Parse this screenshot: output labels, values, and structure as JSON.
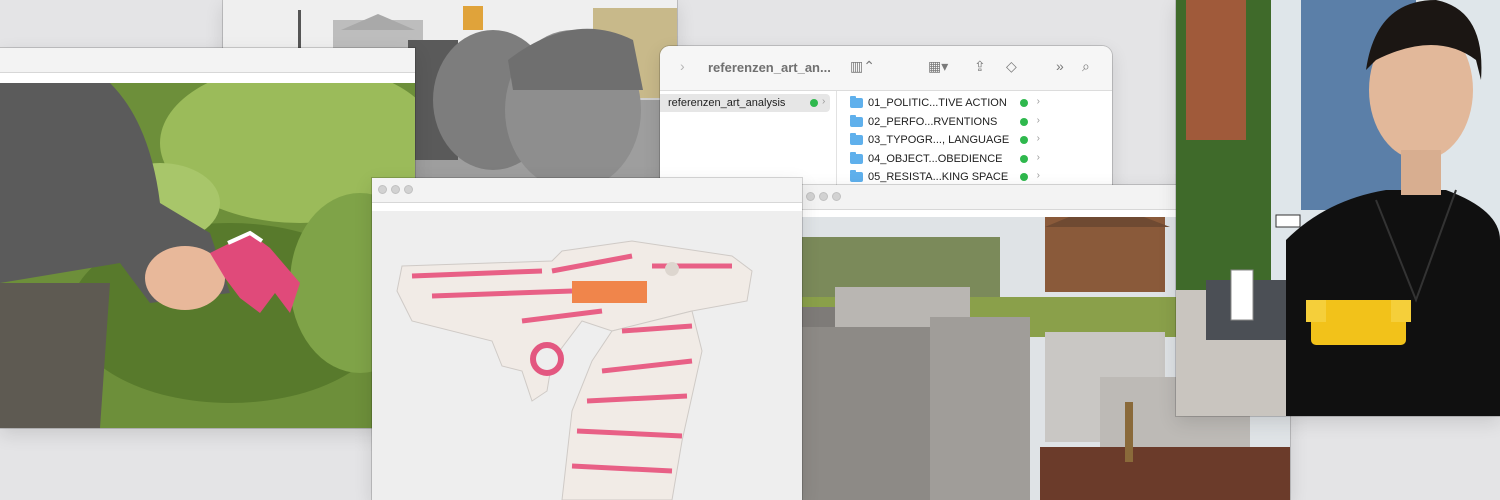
{
  "finder": {
    "title": "referenzen_art_an...",
    "sidebar_item": "referenzen_art_analysis",
    "folders": [
      "01_POLITIC...TIVE ACTION",
      "02_PERFO...RVENTIONS",
      "03_TYPOGR..., LANGUAGE",
      "04_OBJECT...OBEDIENCE",
      "05_RESISTA...KING SPACE"
    ],
    "sync_color": "#2fb84d",
    "folder_color": "#5fb0ec"
  },
  "icons": {
    "forward": "chevron-right-icon",
    "view": "columns-view-icon",
    "grid": "grid-view-icon",
    "share": "share-icon",
    "tag": "tag-icon",
    "more": "double-chevron-icon",
    "search": "search-icon"
  }
}
